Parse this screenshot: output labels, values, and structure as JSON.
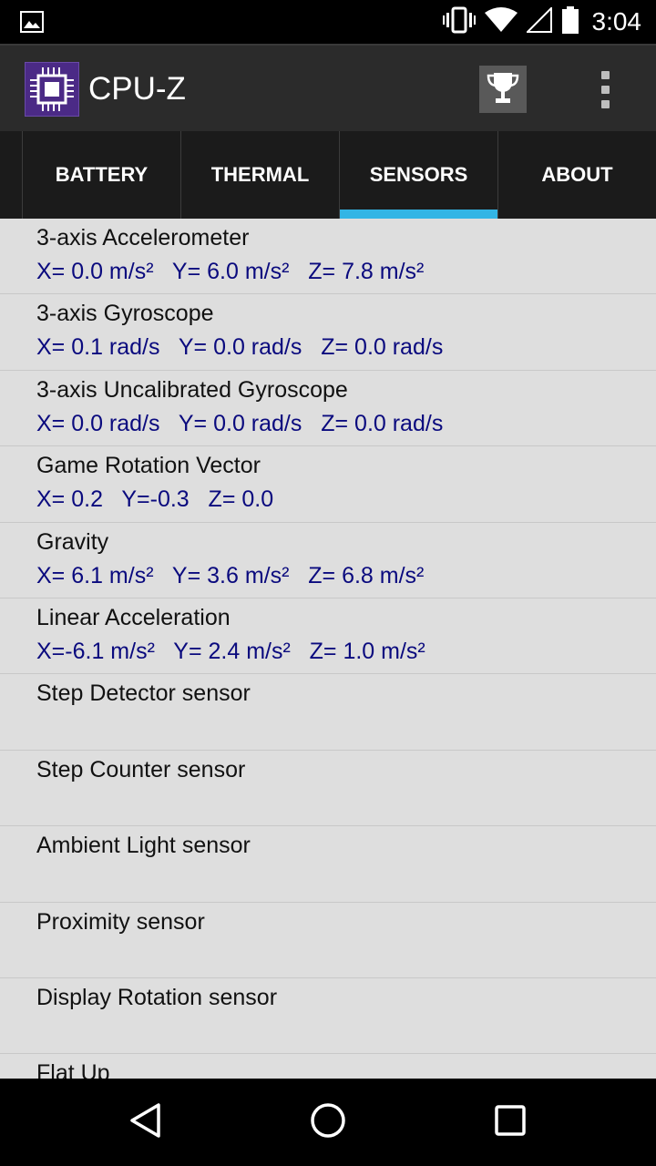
{
  "status_bar": {
    "time": "3:04",
    "icons": [
      "image-notification-icon",
      "vibrate-icon",
      "wifi-icon",
      "signal-icon",
      "battery-icon"
    ]
  },
  "app_bar": {
    "title": "CPU-Z",
    "actions": [
      "trophy-icon",
      "overflow-menu-icon"
    ]
  },
  "tabs": [
    {
      "label": "BATTERY",
      "active": false
    },
    {
      "label": "THERMAL",
      "active": false
    },
    {
      "label": "SENSORS",
      "active": true
    },
    {
      "label": "ABOUT",
      "active": false
    }
  ],
  "colors": {
    "tab_indicator": "#33b5e5",
    "value_text": "#0a0a7e",
    "list_bg": "#dedede",
    "app_bar_bg": "#2b2b2b"
  },
  "sensors": [
    {
      "name": "3-axis Accelerometer",
      "value": "X= 0.0 m/s²   Y= 6.0 m/s²   Z= 7.8 m/s²"
    },
    {
      "name": "3-axis Gyroscope",
      "value": "X= 0.1 rad/s   Y= 0.0 rad/s   Z= 0.0 rad/s"
    },
    {
      "name": "3-axis Uncalibrated Gyroscope",
      "value": "X= 0.0 rad/s   Y= 0.0 rad/s   Z= 0.0 rad/s"
    },
    {
      "name": "Game Rotation Vector",
      "value": "X= 0.2   Y=-0.3   Z= 0.0"
    },
    {
      "name": "Gravity",
      "value": "X= 6.1 m/s²   Y= 3.6 m/s²   Z= 6.8 m/s²"
    },
    {
      "name": "Linear Acceleration",
      "value": "X=-6.1 m/s²   Y= 2.4 m/s²   Z= 1.0 m/s²"
    },
    {
      "name": "Step Detector sensor",
      "value": ""
    },
    {
      "name": "Step Counter sensor",
      "value": ""
    },
    {
      "name": "Ambient Light sensor",
      "value": ""
    },
    {
      "name": "Proximity sensor",
      "value": ""
    },
    {
      "name": "Display Rotation sensor",
      "value": ""
    },
    {
      "name": "Flat Up",
      "value": ""
    }
  ],
  "nav_bar": {
    "buttons": [
      "back-icon",
      "home-icon",
      "recents-icon"
    ]
  }
}
